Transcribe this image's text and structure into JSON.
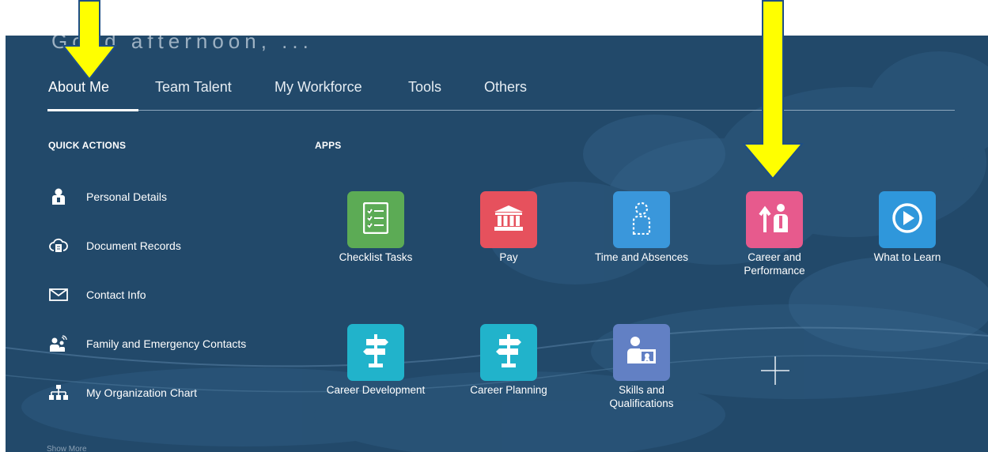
{
  "page_title_partial": "Good afternoon, ...",
  "tabs": [
    {
      "label": "About Me",
      "active": true
    },
    {
      "label": "Team Talent",
      "active": false
    },
    {
      "label": "My Workforce",
      "active": false
    },
    {
      "label": "Tools",
      "active": false
    },
    {
      "label": "Others",
      "active": false
    }
  ],
  "quick_actions": {
    "heading": "QUICK ACTIONS",
    "items": [
      {
        "label": "Personal Details",
        "icon": "person-badge-icon"
      },
      {
        "label": "Document Records",
        "icon": "cloud-document-icon"
      },
      {
        "label": "Contact Info",
        "icon": "envelope-icon"
      },
      {
        "label": "Family and Emergency Contacts",
        "icon": "family-contacts-icon"
      },
      {
        "label": "My Organization Chart",
        "icon": "org-chart-icon"
      }
    ]
  },
  "apps": {
    "heading": "APPS",
    "items": [
      {
        "label": "Checklist Tasks",
        "icon": "checklist-icon",
        "color": "#5cab55"
      },
      {
        "label": "Pay",
        "icon": "bank-icon",
        "color": "#e6515d"
      },
      {
        "label": "Time and Absences",
        "icon": "dotted-person-icon",
        "color": "#3a97db"
      },
      {
        "label": "Career and Performance",
        "icon": "career-growth-icon",
        "color": "#e75a8d"
      },
      {
        "label": "What to Learn",
        "icon": "play-circle-icon",
        "color": "#2f97db"
      },
      {
        "label": "Career Development",
        "icon": "signpost-icon",
        "color": "#21b3cb"
      },
      {
        "label": "Career Planning",
        "icon": "signpost-icon",
        "color": "#21b3cb"
      },
      {
        "label": "Skills and Qualifications",
        "icon": "person-certificate-icon",
        "color": "#6280c4"
      }
    ]
  },
  "add_app_icon": "plus-icon",
  "footer_partial": "Show More",
  "annotation_arrows": {
    "color": "#ffff00",
    "targets": [
      "About Me",
      "Career and Performance"
    ]
  }
}
